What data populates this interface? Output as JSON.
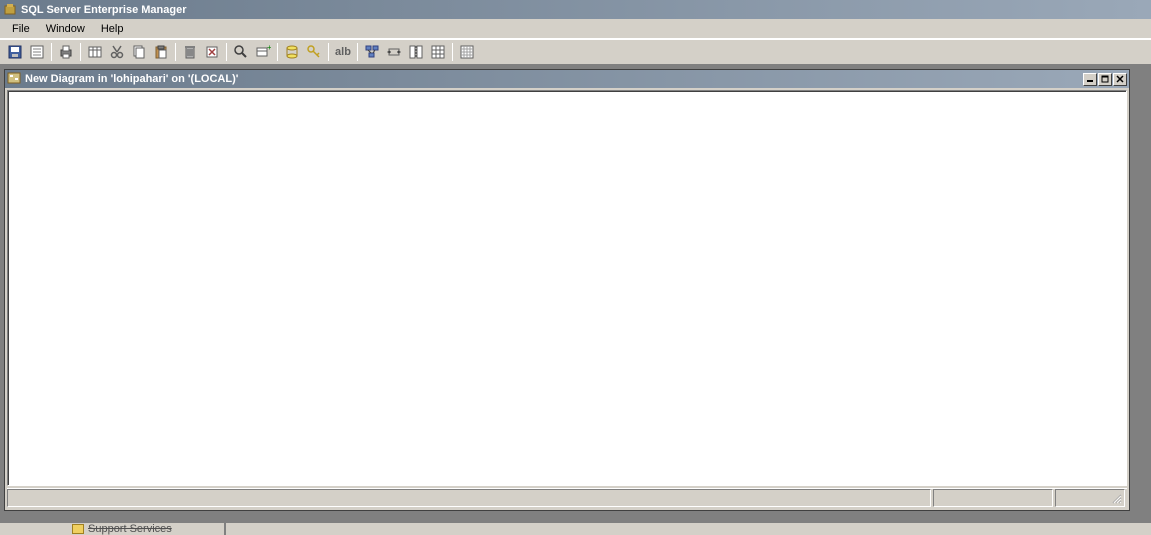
{
  "app": {
    "title": "SQL Server Enterprise Manager"
  },
  "menu": {
    "file": "File",
    "window": "Window",
    "help": "Help"
  },
  "toolbar": {
    "alb_label": "alb"
  },
  "child_window": {
    "title": "New Diagram in 'lohipahari' on '(LOCAL)'"
  },
  "bottom": {
    "tree_item": "Support Services"
  }
}
